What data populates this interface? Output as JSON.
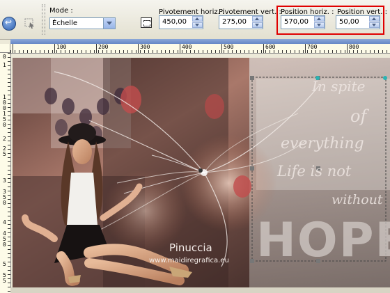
{
  "toolbar": {
    "mode_label": "Mode :",
    "mode_value": "Échelle",
    "fields": [
      {
        "label": "Pivotement horiz. :",
        "value": "450,00"
      },
      {
        "label": "Pivotement vert. :",
        "value": "275,00"
      },
      {
        "label": "Position horiz. :",
        "value": "570,00"
      },
      {
        "label": "Position vert. :",
        "value": "50,00"
      }
    ],
    "highlight_color": "#e00000"
  },
  "ruler": {
    "h_labels": [
      "100",
      "200",
      "300",
      "400",
      "500",
      "600",
      "700",
      "800"
    ],
    "v_labels": [
      "0",
      "1",
      "1 0 0",
      "1 5 0",
      "2",
      "2 5",
      "3",
      "3 5 0",
      "4",
      "4 5 0",
      "5",
      "5 5"
    ]
  },
  "artwork": {
    "quote_lines": [
      "In spite",
      "of",
      "everything",
      "Life is not",
      "without"
    ],
    "hope_text": "HOPE",
    "signature": "Pinuccia",
    "website": "www.maidiregrafica.eu"
  }
}
